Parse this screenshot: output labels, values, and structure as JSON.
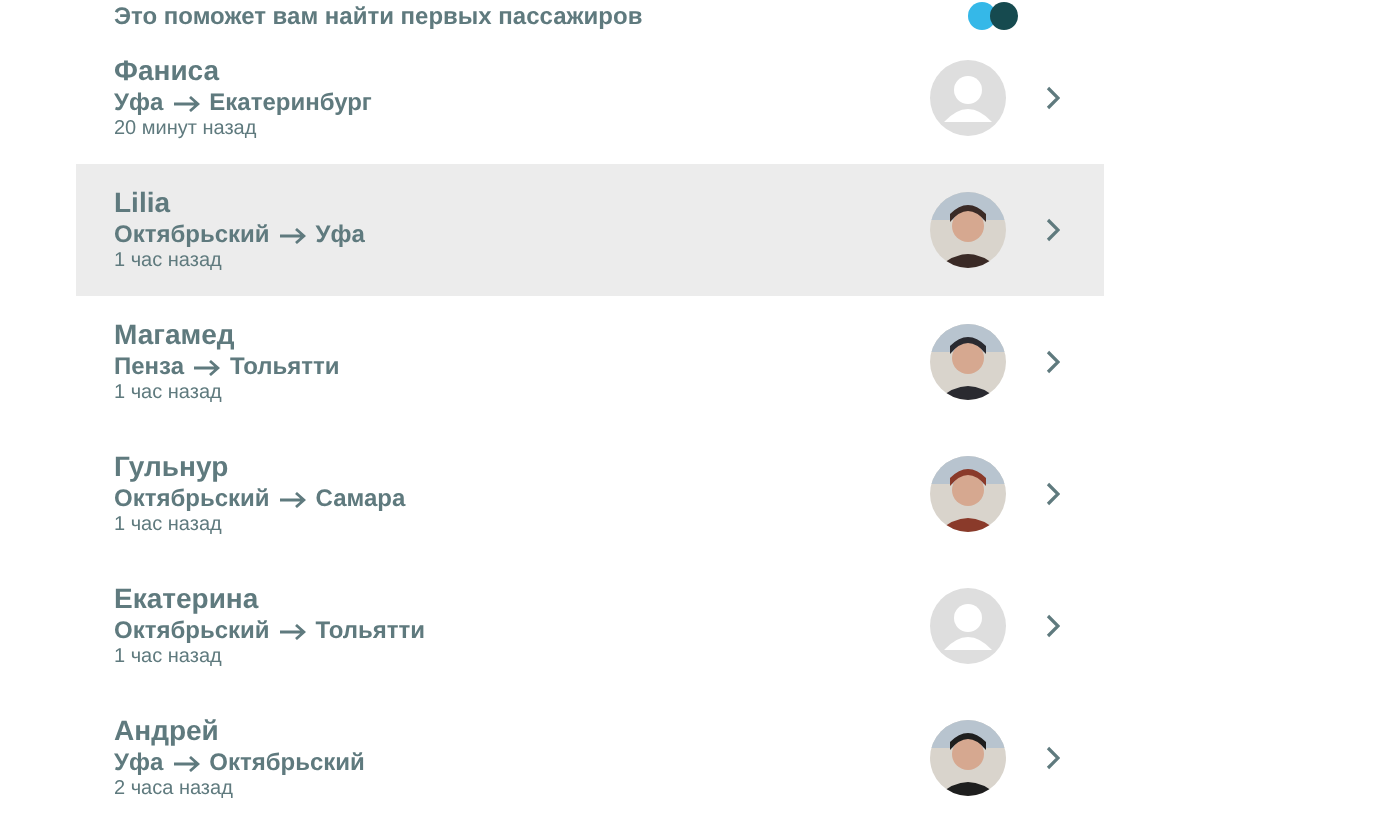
{
  "hint": "Это поможет вам найти первых пассажиров",
  "requests": [
    {
      "name": "Фаниса",
      "from": "Уфа",
      "to": "Екатеринбург",
      "time": "20 минут назад",
      "kind": "placeholder",
      "selected": false
    },
    {
      "name": "Lilia",
      "from": "Октябрьский",
      "to": "Уфа",
      "time": "1 час назад",
      "color": "#3a2a26",
      "selected": true
    },
    {
      "name": "Магамед",
      "from": "Пенза",
      "to": "Тольятти",
      "time": "1 час назад",
      "color": "#2a2a30",
      "selected": false
    },
    {
      "name": "Гульнур",
      "from": "Октябрьский",
      "to": "Самара",
      "time": "1 час назад",
      "color": "#8a3a2a",
      "selected": false
    },
    {
      "name": "Екатерина",
      "from": "Октябрьский",
      "to": "Тольятти",
      "time": "1 час назад",
      "kind": "placeholder",
      "selected": false
    },
    {
      "name": "Андрей",
      "from": "Уфа",
      "to": "Октябрьский",
      "time": "2 часа назад",
      "color": "#1e1e1e",
      "selected": false
    }
  ]
}
